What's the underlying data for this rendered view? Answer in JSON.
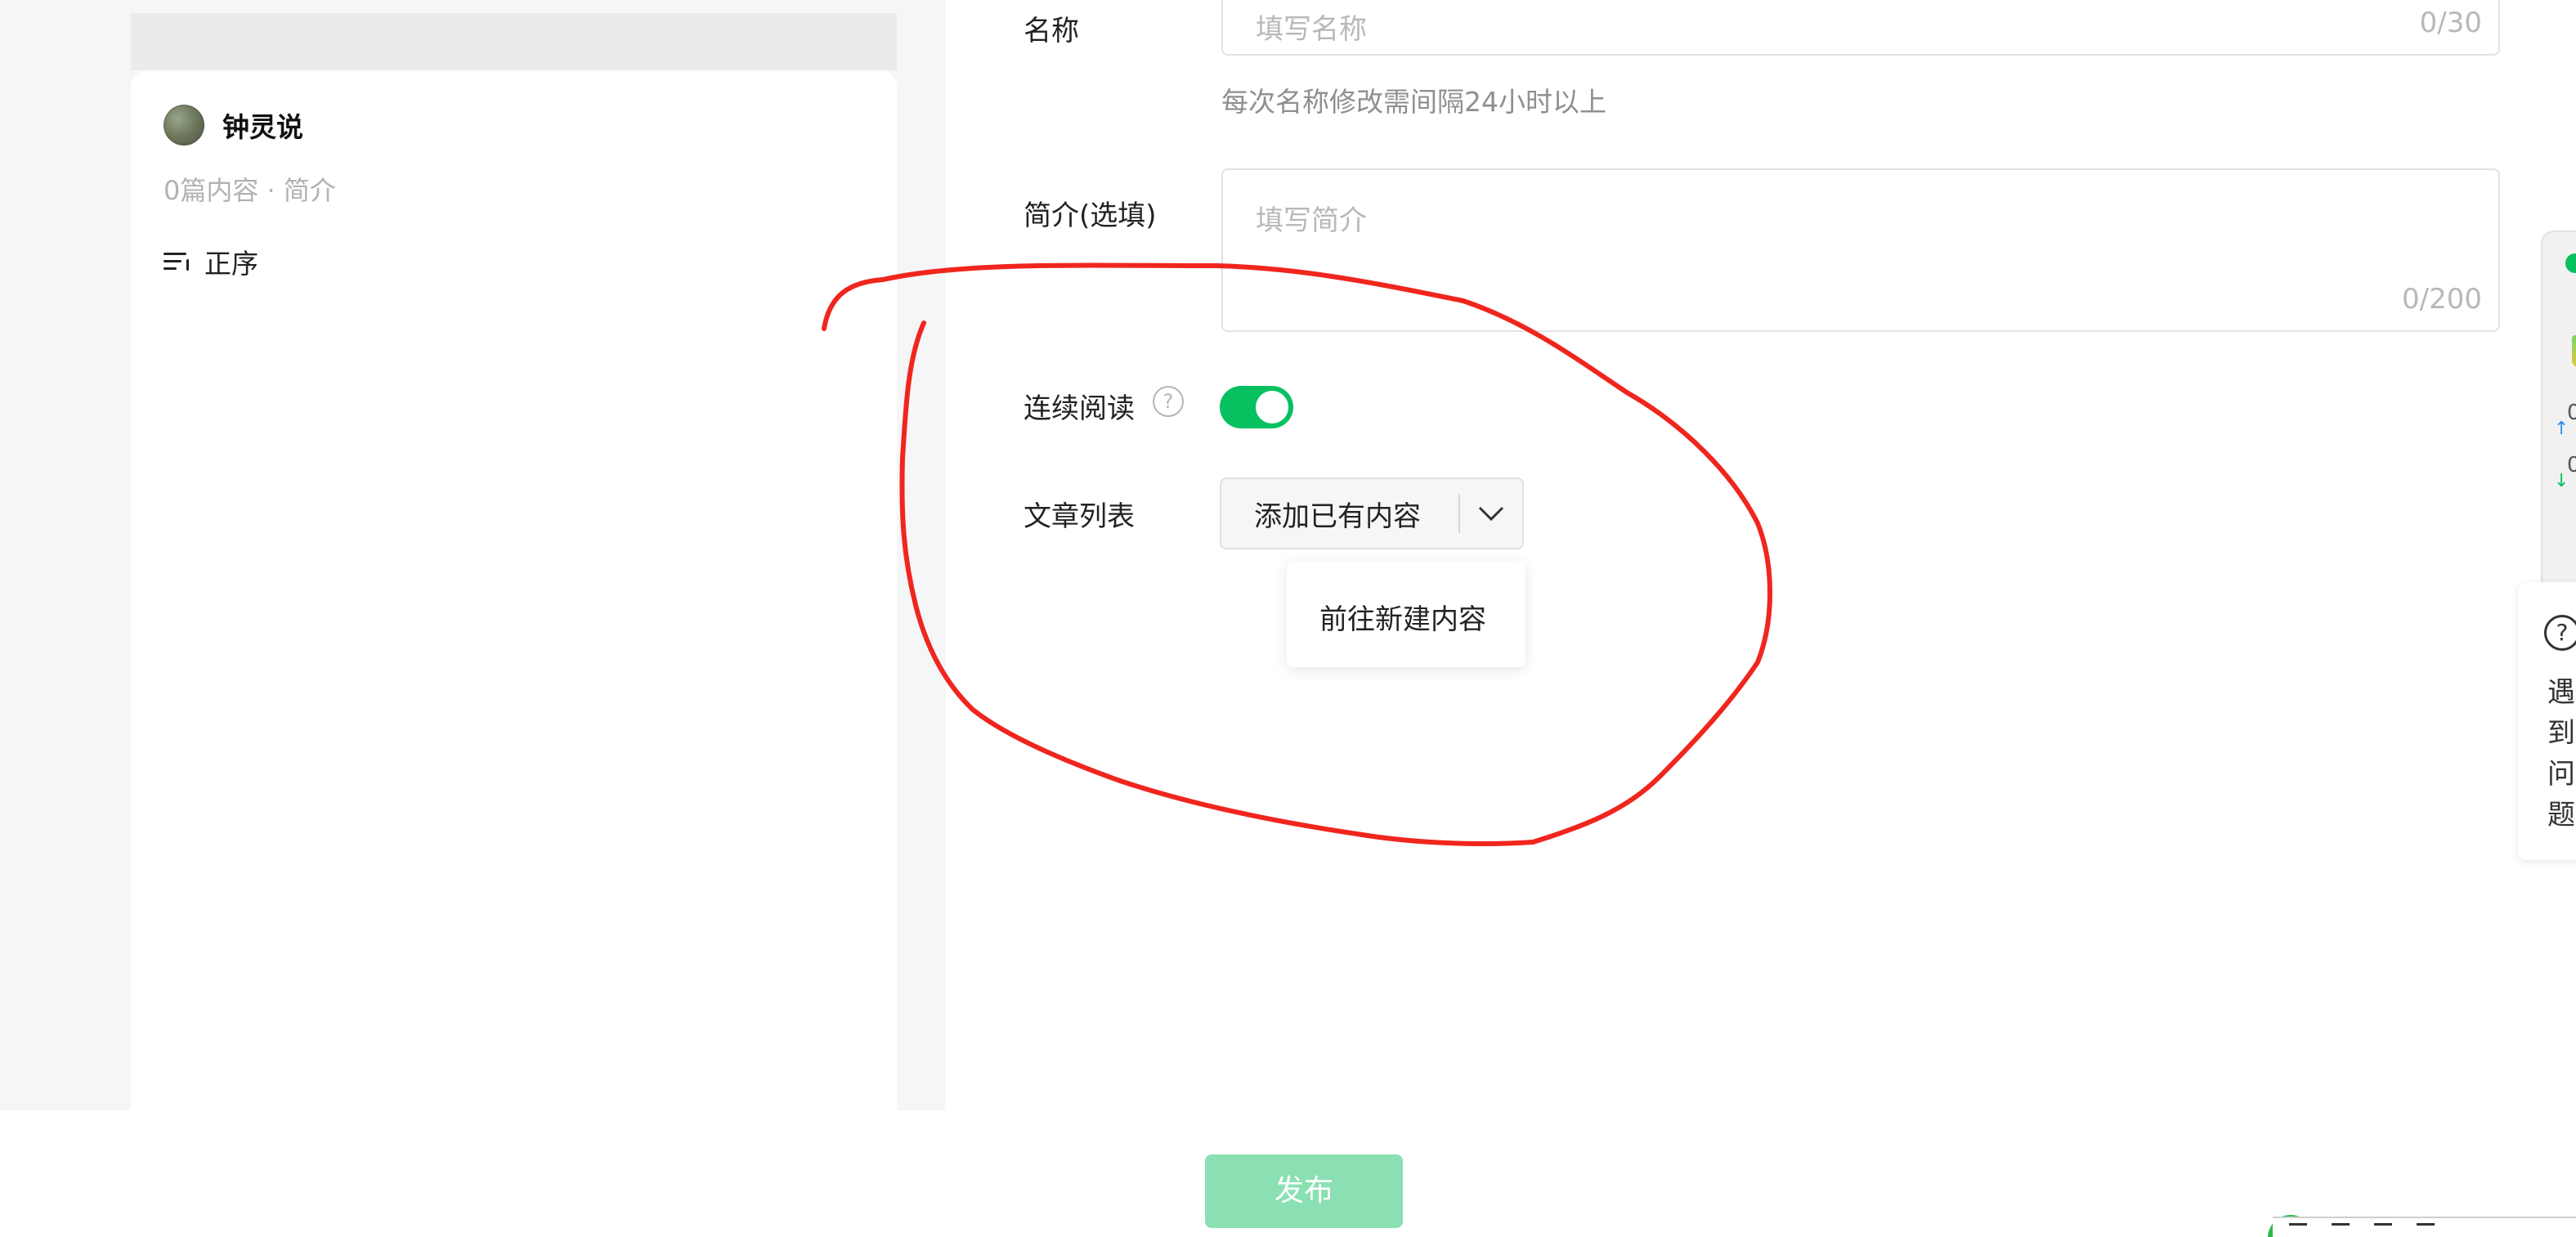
{
  "preview": {
    "author_name": "钟灵说",
    "author_sub": "0篇内容 · 简介",
    "sort_label": "正序"
  },
  "form": {
    "name_label": "名称",
    "name_placeholder": "填写名称",
    "name_count": "0/30",
    "name_hint": "每次名称修改需间隔24小时以上",
    "desc_label": "简介(选填)",
    "desc_placeholder": "填写简介",
    "desc_count": "0/200",
    "continuous_label": "连续阅读",
    "continuous_enabled": true,
    "article_list_label": "文章列表",
    "add_existing_label": "添加已有内容",
    "dropdown_items": [
      "前往新建内容"
    ]
  },
  "footer": {
    "publish_label": "发布"
  },
  "side": {
    "num_up": "0",
    "num_down": "0",
    "help_text": "遇到问题"
  },
  "colors": {
    "accent_green": "#07c160",
    "publish_disabled": "#8ae0b2",
    "annotation_red": "#f0261e"
  }
}
